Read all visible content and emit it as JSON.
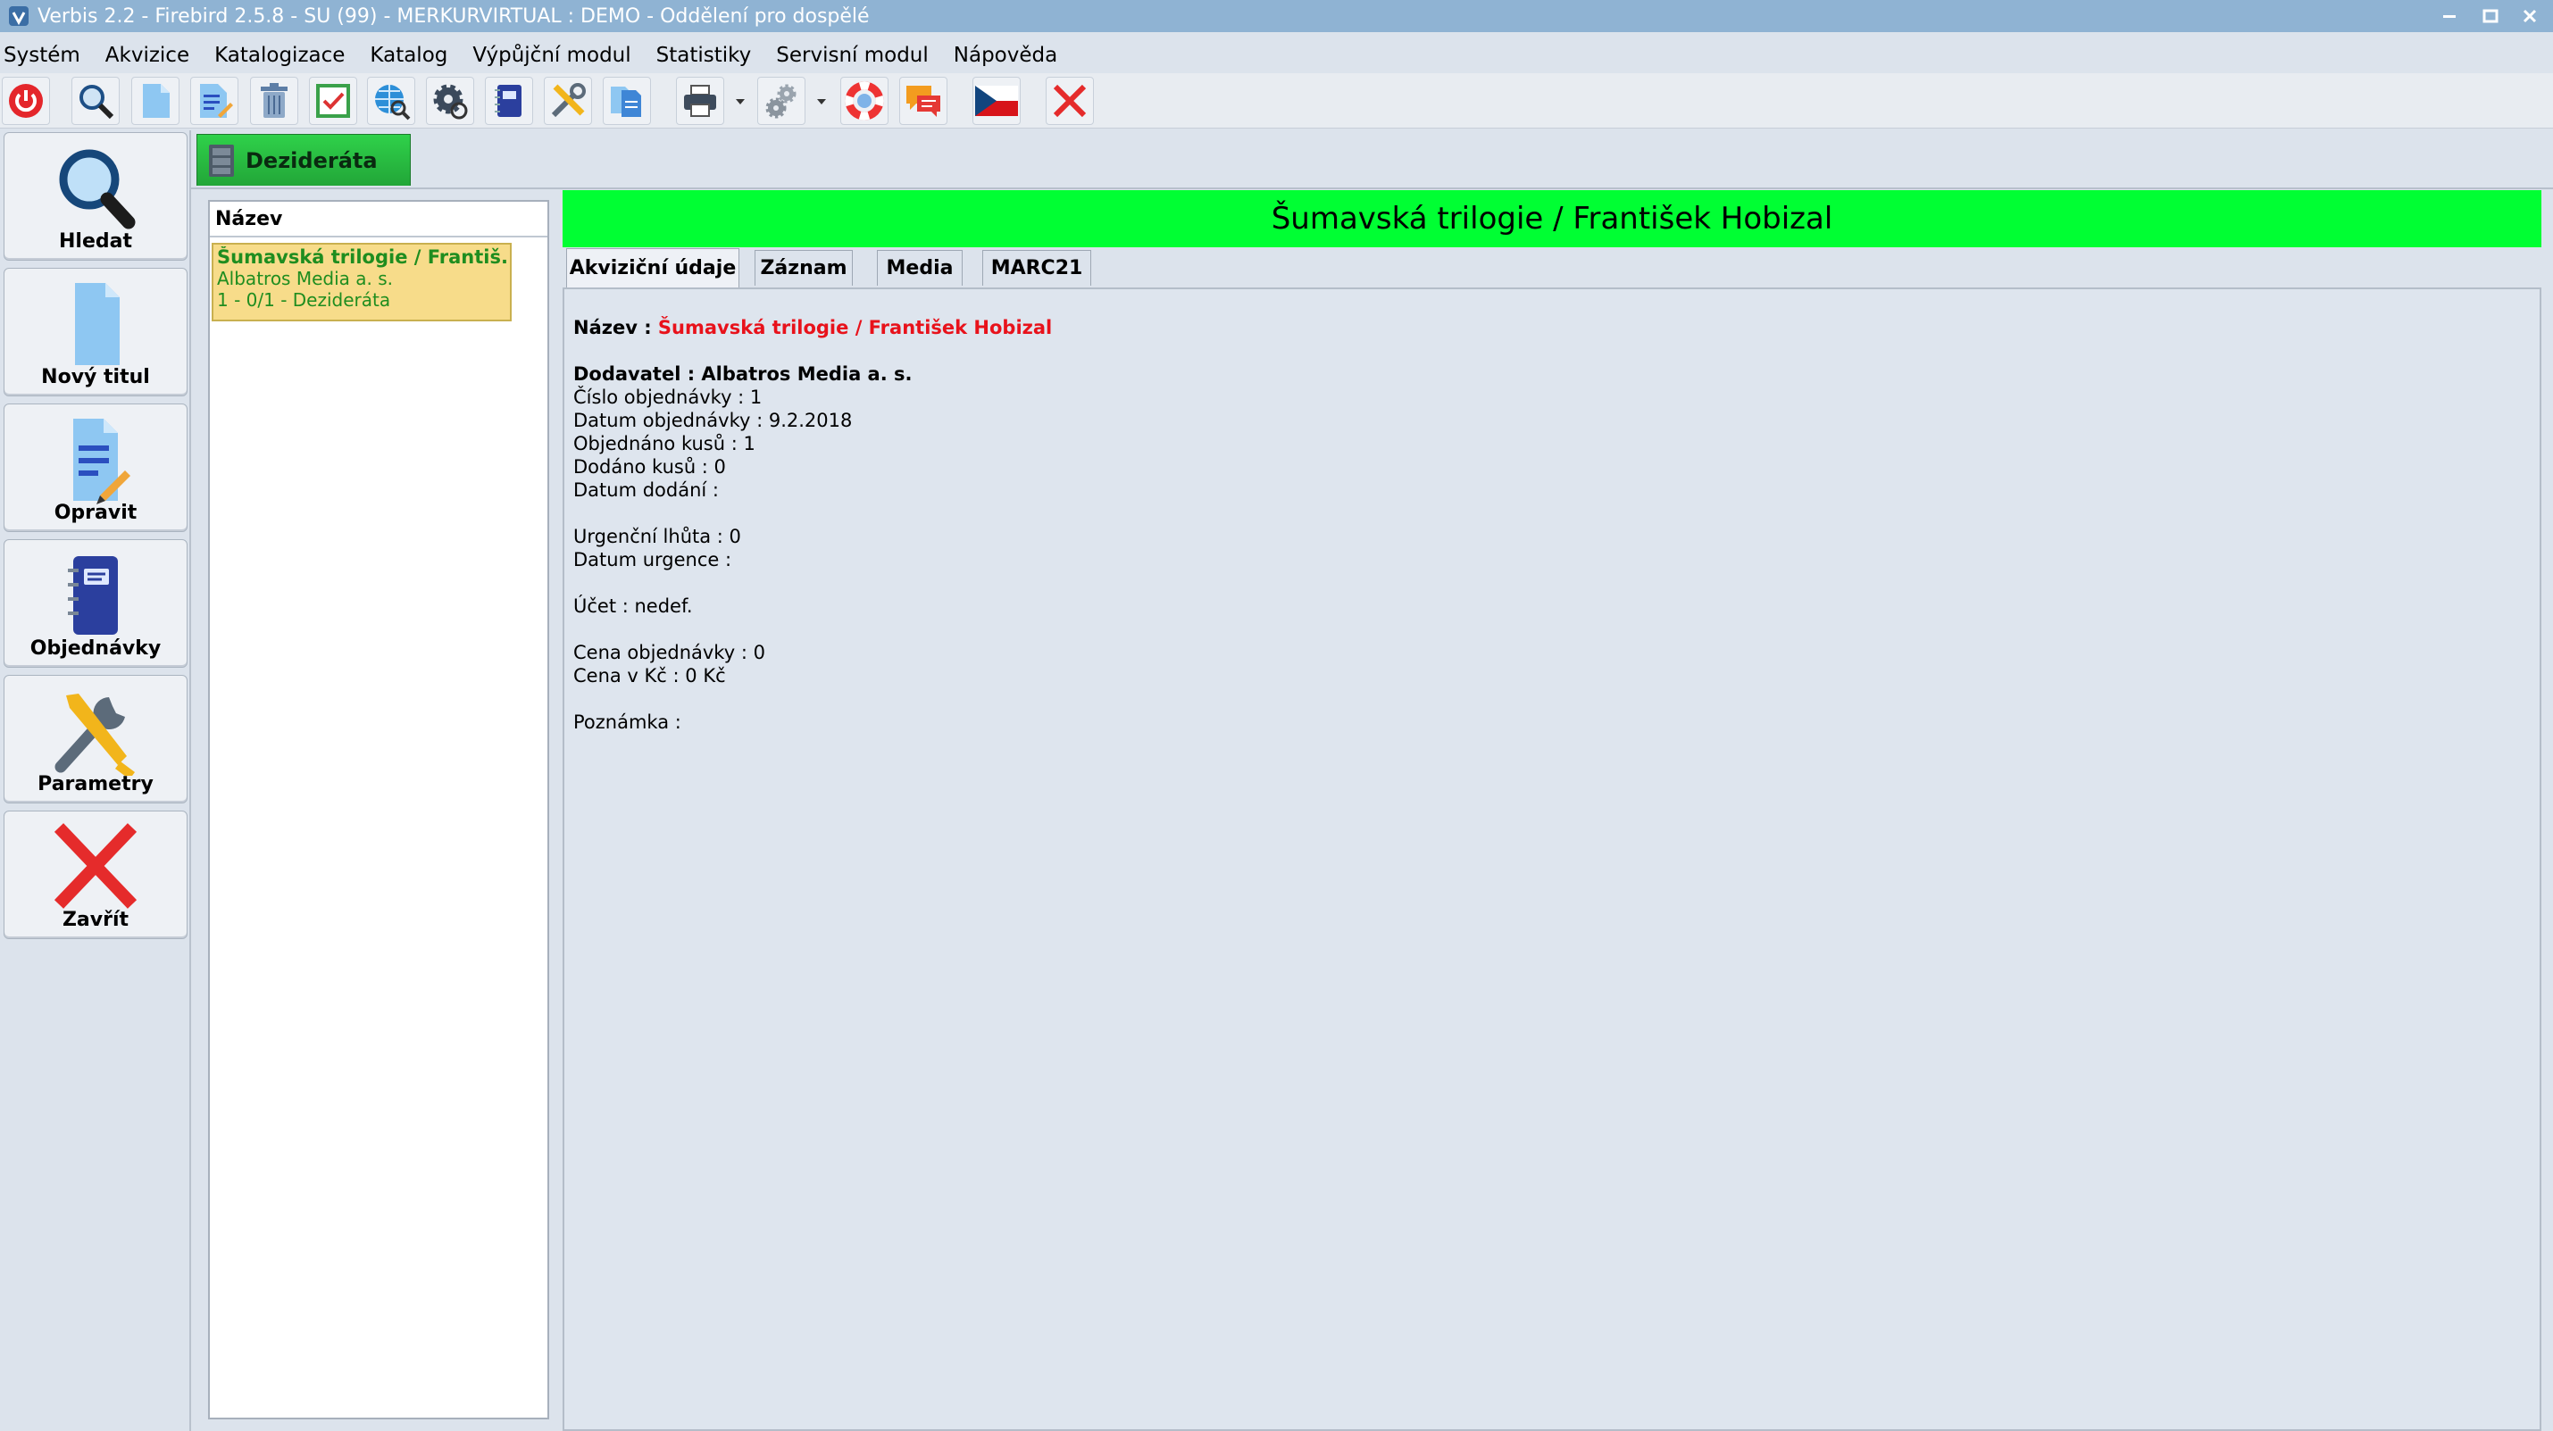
{
  "window": {
    "title": "Verbis 2.2 - Firebird 2.5.8 - SU (99) - MERKURVIRTUAL : DEMO - Oddělení pro dospělé",
    "icons": [
      "app-logo-icon",
      "minimize-icon",
      "maximize-icon",
      "close-icon"
    ]
  },
  "menu": {
    "items": [
      "Systém",
      "Akvizice",
      "Katalogizace",
      "Katalog",
      "Výpůjční modul",
      "Statistiky",
      "Servisní modul",
      "Nápověda"
    ]
  },
  "toolbar": {
    "icons": [
      "power-icon",
      "search-icon",
      "new-document-icon",
      "edit-document-icon",
      "trash-icon",
      "checkbox-icon",
      "globe-search-icon",
      "settings-gear-icon",
      "notebook-icon",
      "tools-icon",
      "documents-icon",
      "printer-icon",
      "gears-icon",
      "lifebuoy-icon",
      "chat-icon",
      "czech-flag-icon",
      "close-x-icon"
    ]
  },
  "sidebar": {
    "buttons": [
      {
        "label": "Hledat",
        "icon": "magnifier-icon"
      },
      {
        "label": "Nový titul",
        "icon": "new-page-icon"
      },
      {
        "label": "Opravit",
        "icon": "edit-page-icon"
      },
      {
        "label": "Objednávky",
        "icon": "order-book-icon"
      },
      {
        "label": "Parametry",
        "icon": "wrench-screwdriver-icon"
      },
      {
        "label": "Zavřít",
        "icon": "red-x-icon"
      }
    ]
  },
  "tab": {
    "label": "Dezideráta"
  },
  "list": {
    "header": "Název",
    "items": [
      {
        "title": "Šumavská trilogie / Františ...",
        "publisher": "Albatros Media a. s.",
        "status": "1 - 0/1 - Dezideráta"
      }
    ]
  },
  "detail": {
    "banner": "Šumavská trilogie / František Hobizal",
    "tabs": [
      "Akviziční údaje",
      "Záznam",
      "Media",
      "MARC21"
    ],
    "active_tab": "Akviziční údaje",
    "name_label": "Název : ",
    "name_value": "Šumavská trilogie / František Hobizal",
    "supplier": "Dodavatel : Albatros Media a. s.",
    "order_number": "Číslo objednávky : 1",
    "order_date": "Datum objednávky : 9.2.2018",
    "ordered_count": "Objednáno kusů : 1",
    "delivered_count": "Dodáno kusů : 0",
    "delivery_date": "Datum dodání :",
    "urgency_period": "Urgenční lhůta : 0",
    "urgency_date": "Datum urgence :",
    "account": "Účet : nedef.",
    "order_price": "Cena objednávky : 0",
    "price_czk": "Cena v Kč : 0 Kč",
    "note": "Poznámka :"
  },
  "colors": {
    "banner": "#00ff33",
    "tab_green": "#22a638",
    "list_item_bg": "#f7dc8a",
    "list_item_text": "#1f8d1f",
    "name_red": "#e8121b",
    "titlebar": "#8fb3d3"
  }
}
